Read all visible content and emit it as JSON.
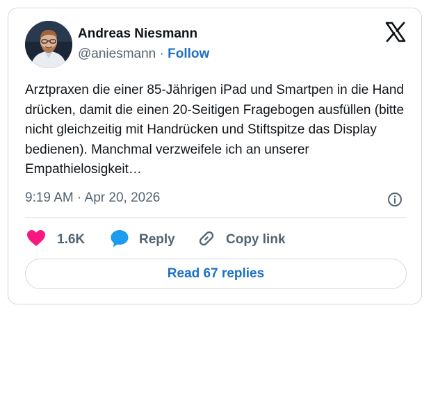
{
  "author": {
    "name": "Andreas Niesmann",
    "handle": "@aniesmann",
    "separator": "·",
    "follow_label": "Follow"
  },
  "tweet": {
    "text": "Arztpraxen die einer 85-Jährigen iPad und Smartpen in die Hand drücken, damit die einen 20-Seitigen Fragebogen ausfüllen (bitte nicht gleichzeitig mit Handrücken und Stiftspitze das Display bedienen). Manchmal verzweifele ich an unserer Empathielosigkeit…",
    "timestamp": "9:19 AM · Apr 20, 2026"
  },
  "actions": {
    "likes_count": "1.6K",
    "reply_label": "Reply",
    "copy_link_label": "Copy link"
  },
  "read_replies_label": "Read 67 replies",
  "icons": {
    "logo": "x-logo-icon",
    "info": "info-icon",
    "like": "heart-icon",
    "reply": "speech-bubble-icon",
    "copy": "link-icon"
  },
  "colors": {
    "accent": "#1d70c9",
    "heart": "#f91880",
    "reply_bubble": "#1d9bf0",
    "muted": "#536471",
    "border": "#cfd9de"
  }
}
